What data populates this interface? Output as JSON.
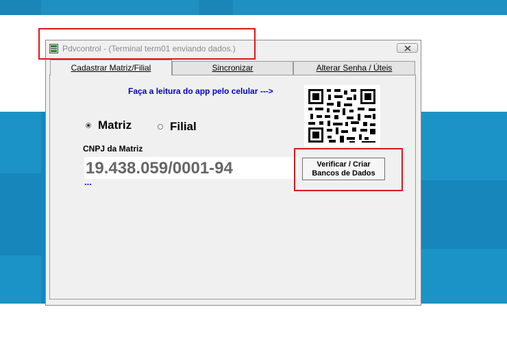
{
  "window": {
    "title": "Pdvcontrol - (Terminal term01 enviando dados.)"
  },
  "tabs": [
    {
      "label": "Cadastrar Matriz/Filial",
      "active": true
    },
    {
      "label": "Sincronizar",
      "active": false
    },
    {
      "label": "Alterar Senha / Úteis",
      "active": false
    }
  ],
  "panel": {
    "qr_hint": "Faça a leitura do app pelo celular --->",
    "radio_matriz": {
      "label": "Matriz",
      "selected": true
    },
    "radio_filial": {
      "label": "Filial",
      "selected": false
    },
    "cnpj_label": "CNPJ da Matriz",
    "cnpj_value": "19.438.059/0001-94",
    "status_dots": "...",
    "verify_button": {
      "line1": "Verificar / Criar",
      "line2": "Bancos de Dados"
    }
  },
  "colors": {
    "hint_text": "#0000cc",
    "annotation": "#e0141c",
    "background": "#1786ba"
  },
  "icons": {
    "app": "pdv-app-icon",
    "close": "close-icon",
    "qr": "qr-code-icon"
  }
}
